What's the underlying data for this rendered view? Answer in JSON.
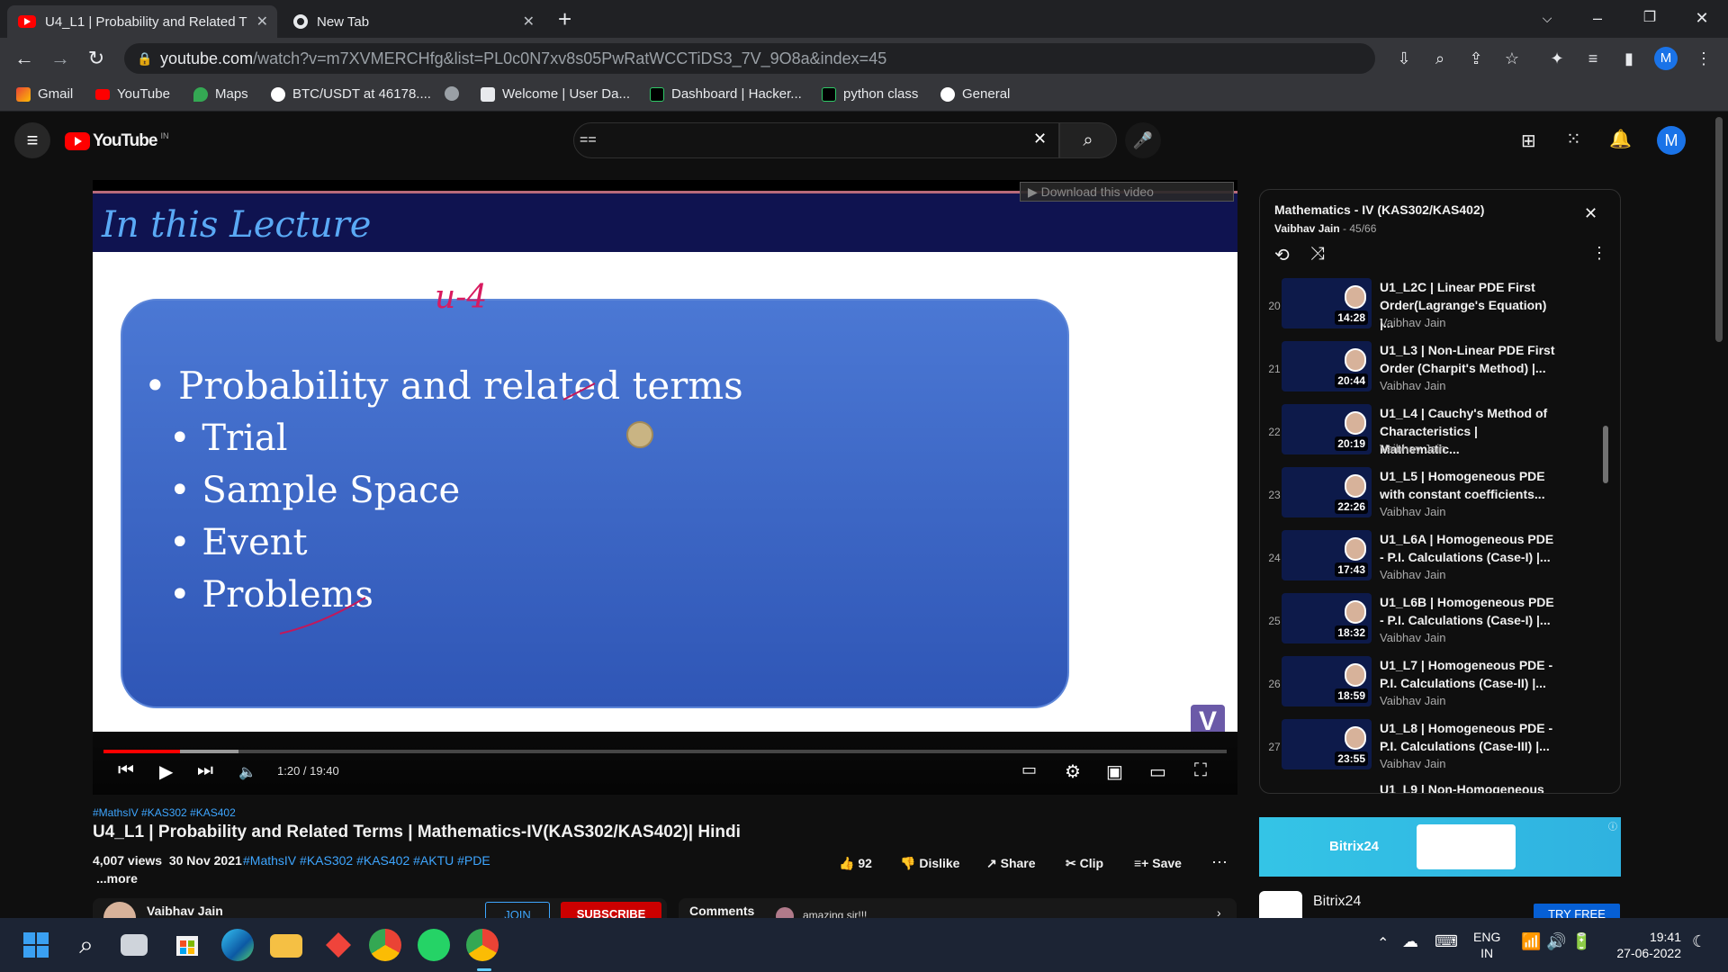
{
  "browser": {
    "tabs": [
      {
        "title": "U4_L1 | Probability and Related T",
        "active": true
      },
      {
        "title": "New Tab",
        "active": false
      }
    ],
    "url_host": "youtube.com",
    "url_path": "/watch?v=m7XVMERCHfg&list=PL0c0N7xv8s05PwRatWCCTiDS3_7V_9O8a&index=45",
    "profile_initial": "M",
    "bookmarks": [
      "Gmail",
      "YouTube",
      "Maps",
      "BTC/USDT at 46178....",
      "",
      "Welcome | User Da...",
      "Dashboard | Hacker...",
      "python class",
      "General"
    ]
  },
  "youtube": {
    "logo_text": "YouTube",
    "region": "IN",
    "search_value": "==",
    "avatar_initial": "M"
  },
  "video": {
    "download_label": "Download this video",
    "slide_heading": "In this Lecture",
    "handwriting": "u-4",
    "bullets": [
      "Probability and related terms",
      "Trial",
      "Sample Space",
      "Event",
      "Problems"
    ],
    "time": "1:20 / 19:40",
    "progress_fraction": 0.068,
    "buffer_fraction": 0.12,
    "watermark": "V"
  },
  "meta": {
    "hashtags": "#MathsIV #KAS302 #KAS402",
    "title": "U4_L1 | Probability and Related Terms | Mathematics-IV(KAS302/KAS402)| Hindi",
    "views": "4,007 views",
    "date": "30 Nov 2021",
    "desc_tags": "#MathsIV  #KAS302 #KAS402 #AKTU #PDE",
    "more": "...more",
    "likes": "92",
    "dislike": "Dislike",
    "share": "Share",
    "clip": "Clip",
    "save": "Save",
    "channel": "Vaibhav Jain",
    "join": "JOIN",
    "subscribe": "SUBSCRIBE",
    "comments": "Comments",
    "comment_preview": "amazing sir!!!"
  },
  "playlist": {
    "title": "Mathematics - IV (KAS302/KAS402)",
    "owner": "Vaibhav Jain",
    "position": "45/66",
    "items": [
      {
        "index": "20",
        "title": "U1_L2C | Linear PDE First Order(Lagrange's Equation) |...",
        "channel": "Vaibhav Jain",
        "duration": "14:28"
      },
      {
        "index": "21",
        "title": "U1_L3 | Non-Linear PDE First Order (Charpit's Method) |...",
        "channel": "Vaibhav Jain",
        "duration": "20:44"
      },
      {
        "index": "22",
        "title": "U1_L4 | Cauchy's Method of Characteristics | Mathematic...",
        "channel": "Vaibhav Jain",
        "duration": "20:19"
      },
      {
        "index": "23",
        "title": "U1_L5 | Homogeneous PDE with constant coefficients...",
        "channel": "Vaibhav Jain",
        "duration": "22:26"
      },
      {
        "index": "24",
        "title": "U1_L6A | Homogeneous PDE - P.I. Calculations (Case-I) |...",
        "channel": "Vaibhav Jain",
        "duration": "17:43"
      },
      {
        "index": "25",
        "title": "U1_L6B | Homogeneous PDE - P.I. Calculations (Case-I) |...",
        "channel": "Vaibhav Jain",
        "duration": "18:32"
      },
      {
        "index": "26",
        "title": "U1_L7 | Homogeneous PDE - P.I. Calculations (Case-II) |...",
        "channel": "Vaibhav Jain",
        "duration": "18:59"
      },
      {
        "index": "27",
        "title": "U1_L8 | Homogeneous PDE - P.I. Calculations (Case-III) |...",
        "channel": "Vaibhav Jain",
        "duration": "23:55"
      }
    ],
    "next_partial_title": "U1_L9 | Non-Homogeneous"
  },
  "ad": {
    "banner_text": "Bitrix24",
    "name": "Bitrix24",
    "cta": "TRY FREE"
  },
  "taskbar": {
    "lang": "ENG",
    "region": "IN",
    "time": "19:41",
    "date": "27-06-2022"
  },
  "colors": {
    "yt_red": "#ff0000",
    "slide_blue": "#3b63c4",
    "link_blue": "#3ea6ff",
    "avatar_blue": "#1a73e8"
  }
}
